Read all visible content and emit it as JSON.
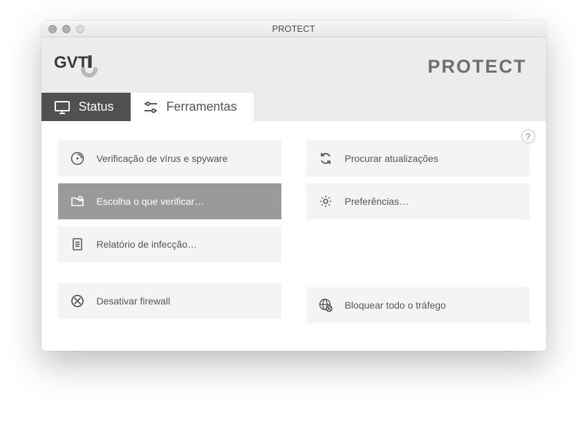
{
  "window": {
    "title": "PROTECT"
  },
  "header": {
    "brand": "PROTECT"
  },
  "tabs": {
    "status": "Status",
    "tools": "Ferramentas"
  },
  "help": "?",
  "actions": {
    "left": {
      "scan": "Verificação de vírus e spyware",
      "choose": "Escolha o que verificar…",
      "report": "Relatório de infecção…",
      "firewall_off": "Desativar firewall"
    },
    "right": {
      "updates": "Procurar atualizações",
      "prefs": "Preferências…",
      "block_traffic": "Bloquear todo o tráfego"
    }
  }
}
